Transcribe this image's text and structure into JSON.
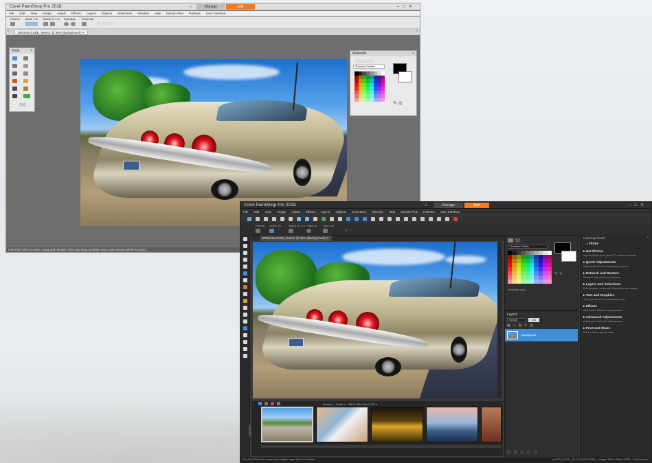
{
  "colors": {
    "edit_tab": "#f47c20",
    "dark_bg": "#3a3a3a",
    "layer_select": "#3f8fd8"
  },
  "app": {
    "title": "Corel PaintShop Pro 2018"
  },
  "tabs": {
    "home_icon": "home-icon",
    "manage": "Manage",
    "edit": "Edit"
  },
  "menu": [
    "File",
    "Edit",
    "View",
    "Image",
    "Adjust",
    "Effects",
    "Layers",
    "Objects",
    "Selections",
    "Window",
    "Help",
    "Dphoto Plus",
    "Palettes",
    "User Interface"
  ],
  "win1": {
    "opt_labels": [
      "Presets",
      "Mode / Hx",
      "Match clr / 1n",
      "Anti-alias",
      "Reset tab"
    ],
    "doc_tab": "IMG8-BACKDE_Interior @ 35% (Background)",
    "tools_title": "Tools",
    "materials_title": "Materials",
    "materials_dropdown": "Standard Palette",
    "status": "Pan Tool: Click to move. Drag and release. Click and drag to define area. Use mouse wheel to zoom..."
  },
  "win2": {
    "opt_labels": [
      "Presets",
      "Object Fit",
      "Match clr / 1n",
      "Hatch clr",
      "Save tab"
    ],
    "doc_tab": "IMG8-BACKDE_Interior @ 36% (Background)",
    "materials_dropdown": "Standard Palette",
    "recently_used": "Recently used",
    "layers_title": "Layers",
    "blend_mode": "Normal",
    "opacity": "100",
    "layer_name": "Background",
    "organizer_label": "Organizer",
    "organizer_sort": "Sort by",
    "organizer_folder": "Folder",
    "organizer_path": "JPEG HPix Paint CFF",
    "learning_center_title": "Learning Center",
    "lc_home": "Home",
    "lc_sections": [
      {
        "title": "Get Photos",
        "desc": "Import photos from your PC, camera or media"
      },
      {
        "title": "Quick Adjustments",
        "desc": "Make quick fixes to improve your photo"
      },
      {
        "title": "Retouch and Restore",
        "desc": "Remove flaws from your photos"
      },
      {
        "title": "Layers and Selections",
        "desc": "Edit localized areas with Selections and Layers"
      },
      {
        "title": "Text and Graphics",
        "desc": "Turn your photo into something new"
      },
      {
        "title": "Effects",
        "desc": "Add artistic effects to your photos"
      },
      {
        "title": "Advanced Adjustments",
        "desc": "Advanced controls & adjustments"
      },
      {
        "title": "Print and Share",
        "desc": "Print or share your photos"
      }
    ],
    "status_left": "Pan Tool: Click and drag to pan images larger than the window.",
    "status_right": "(x:1700 y:1700) - (R:0,G:0,B:0,O:255) -- Image: 3840 x 2560 x RGB - 8 bits/channel"
  }
}
